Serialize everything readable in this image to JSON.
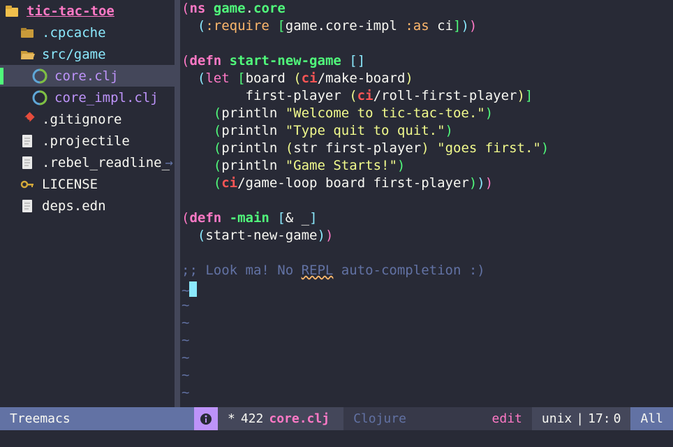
{
  "tree": {
    "project": "tic-tac-toe",
    "nodes": [
      {
        "name": ".cpcache",
        "kind": "folder",
        "depth": 1
      },
      {
        "name": "src/game",
        "kind": "folder-open",
        "depth": 1
      },
      {
        "name": "core.clj",
        "kind": "clj",
        "depth": 2,
        "selected": true
      },
      {
        "name": "core_impl.clj",
        "kind": "clj",
        "depth": 2
      },
      {
        "name": ".gitignore",
        "kind": "git",
        "depth": 1
      },
      {
        "name": ".projectile",
        "kind": "file",
        "depth": 1
      },
      {
        "name": ".rebel_readline_",
        "kind": "file",
        "depth": 1,
        "overflow": true
      },
      {
        "name": "LICENSE",
        "kind": "key",
        "depth": 1
      },
      {
        "name": "deps.edn",
        "kind": "file",
        "depth": 1
      }
    ]
  },
  "status": {
    "left": "Treemacs",
    "modified": "*",
    "size": "422",
    "filename": "core.clj",
    "mode": "Clojure",
    "edit": "edit",
    "encoding": "unix",
    "line": "17",
    "col": "0",
    "percent": "All"
  },
  "code": {
    "lines": [
      [
        {
          "t": "p1",
          "v": "("
        },
        {
          "t": "def",
          "v": "ns"
        },
        {
          "t": "plain",
          "v": " "
        },
        {
          "t": "name",
          "v": "game"
        },
        {
          "t": "plain",
          "v": "."
        },
        {
          "t": "name",
          "v": "core"
        }
      ],
      [
        {
          "t": "plain",
          "v": "  "
        },
        {
          "t": "p2",
          "v": "("
        },
        {
          "t": "attr",
          "v": ":require"
        },
        {
          "t": "plain",
          "v": " "
        },
        {
          "t": "p3",
          "v": "["
        },
        {
          "t": "plain",
          "v": "game.core-impl "
        },
        {
          "t": "attr",
          "v": ":as"
        },
        {
          "t": "plain",
          "v": " ci"
        },
        {
          "t": "p3",
          "v": "]"
        },
        {
          "t": "p2",
          "v": ")"
        },
        {
          "t": "p1",
          "v": ")"
        }
      ],
      [],
      [
        {
          "t": "p1",
          "v": "("
        },
        {
          "t": "def",
          "v": "defn"
        },
        {
          "t": "plain",
          "v": " "
        },
        {
          "t": "name",
          "v": "start-new-game"
        },
        {
          "t": "plain",
          "v": " "
        },
        {
          "t": "p2",
          "v": "["
        },
        {
          "t": "p2",
          "v": "]"
        }
      ],
      [
        {
          "t": "plain",
          "v": "  "
        },
        {
          "t": "p2",
          "v": "("
        },
        {
          "t": "kw",
          "v": "let"
        },
        {
          "t": "plain",
          "v": " "
        },
        {
          "t": "p3",
          "v": "["
        },
        {
          "t": "plain",
          "v": "board "
        },
        {
          "t": "p4",
          "v": "("
        },
        {
          "t": "ns",
          "v": "ci"
        },
        {
          "t": "plain",
          "v": "/make-board"
        },
        {
          "t": "p4",
          "v": ")"
        }
      ],
      [
        {
          "t": "plain",
          "v": "        first-player "
        },
        {
          "t": "p4",
          "v": "("
        },
        {
          "t": "ns",
          "v": "ci"
        },
        {
          "t": "plain",
          "v": "/roll-first-player"
        },
        {
          "t": "p4",
          "v": ")"
        },
        {
          "t": "p3",
          "v": "]"
        }
      ],
      [
        {
          "t": "plain",
          "v": "    "
        },
        {
          "t": "p3",
          "v": "("
        },
        {
          "t": "plain",
          "v": "println "
        },
        {
          "t": "str",
          "v": "\"Welcome to tic-tac-toe.\""
        },
        {
          "t": "p3",
          "v": ")"
        }
      ],
      [
        {
          "t": "plain",
          "v": "    "
        },
        {
          "t": "p3",
          "v": "("
        },
        {
          "t": "plain",
          "v": "println "
        },
        {
          "t": "str",
          "v": "\"Type quit to quit.\""
        },
        {
          "t": "p3",
          "v": ")"
        }
      ],
      [
        {
          "t": "plain",
          "v": "    "
        },
        {
          "t": "p3",
          "v": "("
        },
        {
          "t": "plain",
          "v": "println "
        },
        {
          "t": "p4",
          "v": "("
        },
        {
          "t": "plain",
          "v": "str first-player"
        },
        {
          "t": "p4",
          "v": ")"
        },
        {
          "t": "plain",
          "v": " "
        },
        {
          "t": "str",
          "v": "\"goes first.\""
        },
        {
          "t": "p3",
          "v": ")"
        }
      ],
      [
        {
          "t": "plain",
          "v": "    "
        },
        {
          "t": "p3",
          "v": "("
        },
        {
          "t": "plain",
          "v": "println "
        },
        {
          "t": "str",
          "v": "\"Game Starts!\""
        },
        {
          "t": "p3",
          "v": ")"
        }
      ],
      [
        {
          "t": "plain",
          "v": "    "
        },
        {
          "t": "p3",
          "v": "("
        },
        {
          "t": "ns",
          "v": "ci"
        },
        {
          "t": "plain",
          "v": "/game-loop board first-player"
        },
        {
          "t": "p3",
          "v": ")"
        },
        {
          "t": "p2",
          "v": ")"
        },
        {
          "t": "p1",
          "v": ")"
        }
      ],
      [],
      [
        {
          "t": "p1",
          "v": "("
        },
        {
          "t": "def",
          "v": "defn"
        },
        {
          "t": "plain",
          "v": " "
        },
        {
          "t": "name",
          "v": "-main"
        },
        {
          "t": "plain",
          "v": " "
        },
        {
          "t": "p2",
          "v": "["
        },
        {
          "t": "plain",
          "v": "& _"
        },
        {
          "t": "p2",
          "v": "]"
        }
      ],
      [
        {
          "t": "plain",
          "v": "  "
        },
        {
          "t": "p2",
          "v": "("
        },
        {
          "t": "plain",
          "v": "start-new-game"
        },
        {
          "t": "p2",
          "v": ")"
        },
        {
          "t": "p1",
          "v": ")"
        }
      ],
      [],
      [
        {
          "t": "comm",
          "v": ";; Look ma! No "
        },
        {
          "t": "comm-wavy",
          "v": "REPL"
        },
        {
          "t": "comm",
          "v": " auto-completion :)"
        }
      ]
    ],
    "tildes": 7
  }
}
